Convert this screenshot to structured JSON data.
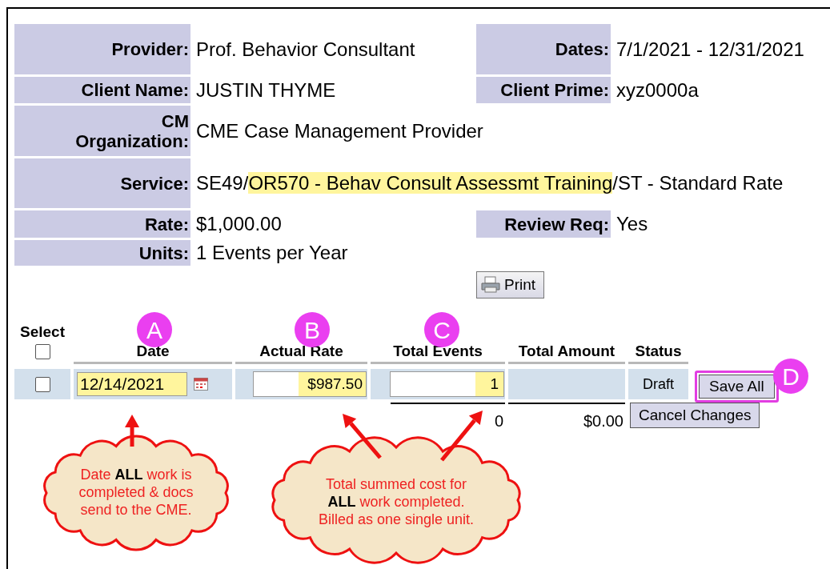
{
  "info_rows": [
    {
      "left": {
        "label": "Provider:",
        "value": [
          {
            "text": "Prof. Behavior Consultant",
            "highlighted": false
          }
        ]
      },
      "right": {
        "label": "Dates:",
        "value": "7/1/2021 - 12/31/2021"
      }
    },
    {
      "left": {
        "label": "Client Name:",
        "value": [
          {
            "text": "JUSTIN THYME",
            "highlighted": false
          }
        ]
      },
      "right": {
        "label": "Client Prime:",
        "value": "xyz0000a"
      }
    },
    {
      "left": {
        "label": "CM Organization:",
        "value": [
          {
            "text": "CME Case Management Provider",
            "highlighted": false
          }
        ]
      }
    },
    {
      "left": {
        "label": "Service:",
        "value": [
          {
            "text": "SE49/",
            "highlighted": false
          },
          {
            "text": "OR570 - Behav Consult Assessmt Training",
            "highlighted": true
          },
          {
            "text": "/ST - Standard Rate",
            "highlighted": false
          }
        ]
      }
    },
    {
      "left": {
        "label": "Rate:",
        "value": [
          {
            "text": "$1,000.00",
            "highlighted": false
          }
        ]
      },
      "right": {
        "label": "Review Req:",
        "value": "Yes"
      }
    },
    {
      "left": {
        "label": "Units:",
        "value": [
          {
            "text": "1 Events per Year",
            "highlighted": false
          }
        ]
      }
    }
  ],
  "print_button": "Print",
  "grid": {
    "columns": [
      "Select",
      "Date",
      "Actual Rate",
      "Total Events",
      "Total Amount",
      "Status"
    ],
    "select_all_checked": false,
    "rows": [
      {
        "checked": false,
        "date": "12/14/2021",
        "actual_rate": "$987.50",
        "total_events": "1",
        "status": "Draft",
        "highlighted": true
      }
    ],
    "totals": {
      "total_events": "0",
      "total_amount": "$0.00"
    },
    "save_button": "Save All",
    "cancel_button": "Cancel Changes"
  },
  "annotations": {
    "badges": [
      "A",
      "B",
      "C",
      "D"
    ],
    "callouts": [
      "Date **ALL** work is completed & docs send to the CME.",
      "Total summed cost for **ALL** work completed. Billed as one single unit."
    ]
  }
}
